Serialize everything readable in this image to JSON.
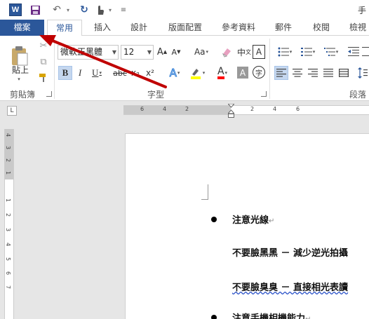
{
  "qat": {
    "word_logo": "W",
    "title": "手"
  },
  "tabs": [
    "檔案",
    "常用",
    "插入",
    "設計",
    "版面配置",
    "參考資料",
    "郵件",
    "校閱",
    "檢視"
  ],
  "clipboard": {
    "paste_label": "貼上",
    "group_label": "剪貼簿"
  },
  "font": {
    "name": "微軟正黑體",
    "size": "12",
    "group_label": "字型",
    "bold": "B",
    "italic": "I",
    "underline": "U",
    "strike": "abc",
    "subscript": "x₂",
    "superscript": "x²",
    "grow": "A",
    "shrink": "A",
    "case": "Aa",
    "phonetic": "中",
    "border": "A",
    "text_effect": "A",
    "color": "A",
    "shade": "A",
    "enclose": "字"
  },
  "paragraph": {
    "group_label": "段落"
  },
  "ruler": {
    "corner": "L",
    "h_numbers": [
      "6",
      "4",
      "2",
      "2",
      "4",
      "6"
    ],
    "v_numbers": [
      "4",
      "3",
      "2",
      "1",
      "1",
      "2",
      "3",
      "4",
      "5",
      "6",
      "7"
    ]
  },
  "document": {
    "lines": [
      {
        "text": "注意光線",
        "bullet": true
      },
      {
        "text": "不要臉黑黑 － 減少逆光拍攝",
        "bullet": false
      },
      {
        "text": "不要臉臭臭 － 直接相光表讀",
        "bullet": false
      },
      {
        "text": "注意手機相機能力",
        "bullet": true
      }
    ],
    "para_mark": "↵"
  },
  "colors": {
    "file_tab": "#2b579a",
    "arrow": "#c00000",
    "highlight": "#ffff00",
    "font_color": "#ff0000"
  }
}
